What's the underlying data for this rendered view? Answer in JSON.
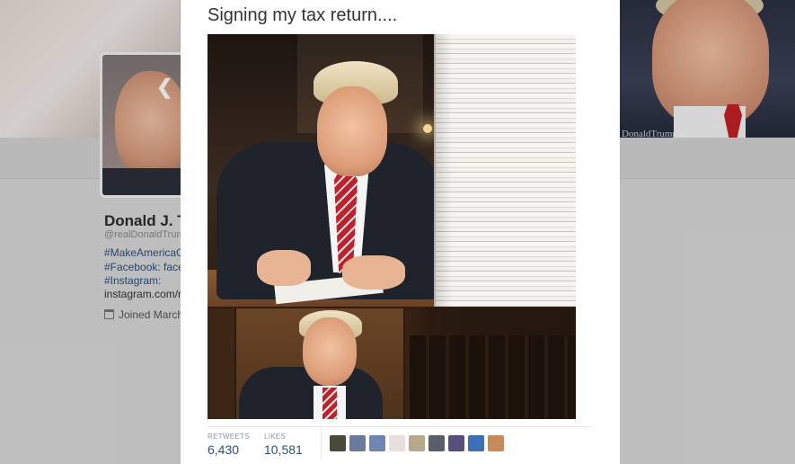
{
  "tweet": {
    "text": "Signing my tax return....",
    "photo_alt": "Photo"
  },
  "stats": {
    "retweets_label": "RETWEETS",
    "retweets_value": "6,430",
    "likes_label": "LIKES",
    "likes_value": "10,581",
    "likers": [
      {
        "color": "#4a4a3a"
      },
      {
        "color": "#6b7a9a"
      },
      {
        "color": "#6f86b0"
      },
      {
        "color": "#e8dede"
      },
      {
        "color": "#b8a88c"
      },
      {
        "color": "#5b5f6a"
      },
      {
        "color": "#5a4f7a"
      },
      {
        "color": "#3f6fb5"
      },
      {
        "color": "#c98a5a"
      }
    ]
  },
  "background_profile": {
    "name": "Donald J. T",
    "screen_name": "@realDonaldTrump",
    "bio_lines": [
      "#MakeAmericaGr",
      "#Facebook: faceb",
      "#Instagram:",
      "instagram.com/re"
    ],
    "joined": "Joined March",
    "banner_handle": "DonaldTrump"
  },
  "icons": {
    "back": "chevron-left-icon",
    "calendar": "calendar-icon"
  }
}
